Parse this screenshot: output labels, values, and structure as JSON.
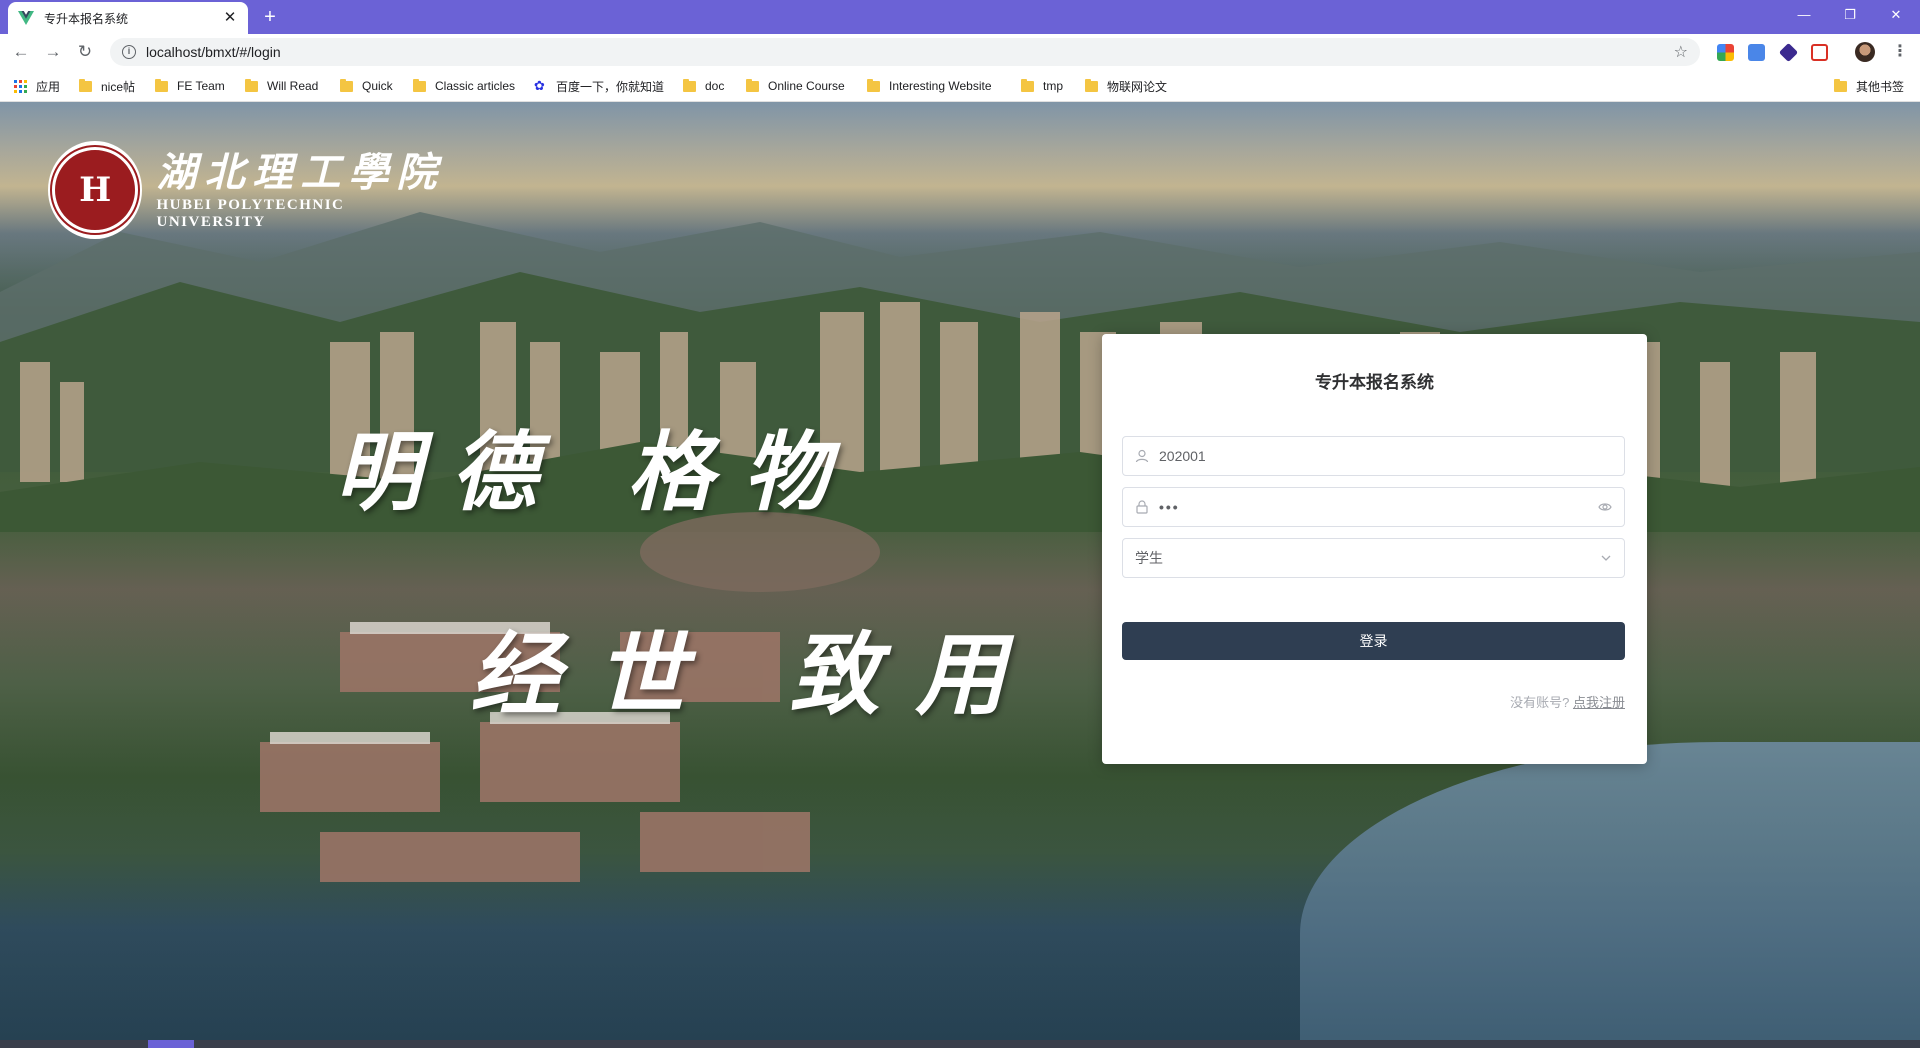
{
  "browser": {
    "tab_title": "专升本报名系统",
    "tab_close": "✕",
    "new_tab": "+",
    "url": "localhost/bmxt/#/login",
    "window_controls": {
      "minimize": "—",
      "restore": "❐",
      "close": "✕"
    },
    "nav": {
      "back": "←",
      "forward": "→",
      "reload": "↻"
    },
    "info_glyph": "i",
    "star": "☆",
    "menu": "⋮"
  },
  "bookmarks": [
    {
      "label": "应用",
      "icon": "apps-grid-icon"
    },
    {
      "label": "nice帖",
      "icon": "folder-icon"
    },
    {
      "label": "FE Team",
      "icon": "folder-icon"
    },
    {
      "label": "Will Read",
      "icon": "folder-icon"
    },
    {
      "label": "Quick",
      "icon": "folder-icon"
    },
    {
      "label": "Classic articles",
      "icon": "folder-icon"
    },
    {
      "label": "百度一下，你就知道",
      "icon": "baidu-paw-icon"
    },
    {
      "label": "doc",
      "icon": "folder-icon"
    },
    {
      "label": "Online Course",
      "icon": "folder-icon"
    },
    {
      "label": "Interesting Website",
      "icon": "folder-icon"
    },
    {
      "label": "tmp",
      "icon": "folder-icon"
    },
    {
      "label": "物联网论文",
      "icon": "folder-icon"
    }
  ],
  "other_bookmarks": "其他书签",
  "logo": {
    "cn": "湖北理工學院",
    "en": "HUBEI  POLYTECHNIC  UNIVERSITY",
    "seal_glyph": "H"
  },
  "motto": {
    "line1": "明德 格物",
    "line2": "经世 致用"
  },
  "login": {
    "title": "专升本报名系统",
    "username_value": "202001",
    "password_masked": "•••",
    "role_value": "学生",
    "submit_label": "登录",
    "no_account_text": "没有账号?",
    "register_link": "点我注册"
  },
  "colors": {
    "tabstrip": "#6b62d6",
    "login_button": "#2f3e52",
    "seal": "#9b1c1f"
  }
}
